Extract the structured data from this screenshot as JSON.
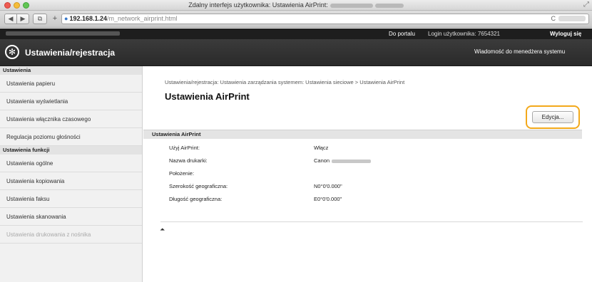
{
  "window": {
    "title": "Zdalny interfejs użytkownika: Ustawienia AirPrint:"
  },
  "browser": {
    "url_host": "192.168.1.24",
    "url_path": "/m_network_airprint.html",
    "reload_icon": "reload-icon"
  },
  "topbar": {
    "portal": "Do portalu",
    "login": "Login użytkownika: 7654321",
    "logout": "Wyloguj się"
  },
  "header": {
    "title": "Ustawienia/rejestracja",
    "message": "Wiadomość do menedżera systemu"
  },
  "sidebar": {
    "section1": "Ustawienia",
    "items1": [
      "Ustawienia papieru",
      "Ustawienia wyświetlania",
      "Ustawienia włącznika czasowego",
      "Regulacja poziomu głośności"
    ],
    "section2": "Ustawienia funkcji",
    "items2": [
      "Ustawienia ogólne",
      "Ustawienia kopiowania",
      "Ustawienia faksu",
      "Ustawienia skanowania",
      "Ustawienia drukowania z nośnika"
    ]
  },
  "main": {
    "breadcrumb": "Ustawienia/rejestracja: Ustawienia zarządzania systemem: Ustawienia sieciowe > Ustawienia AirPrint",
    "title": "Ustawienia AirPrint",
    "edit_button": "Edycja...",
    "section_title": "Ustawienia AirPrint",
    "rows": [
      {
        "label": "Użyj AirPrint:",
        "value": "Włącz"
      },
      {
        "label": "Nazwa drukarki:",
        "value": "Canon"
      },
      {
        "label": "Położenie:",
        "value": ""
      },
      {
        "label": "Szerokość geograficzna:",
        "value": "N0°0'0.000\""
      },
      {
        "label": "Długość geograficzna:",
        "value": "E0°0'0.000\""
      }
    ],
    "back_to_top": "⏶"
  },
  "colors": {
    "highlight": "#f3a91b",
    "header_bg": "#2e2e2e"
  }
}
